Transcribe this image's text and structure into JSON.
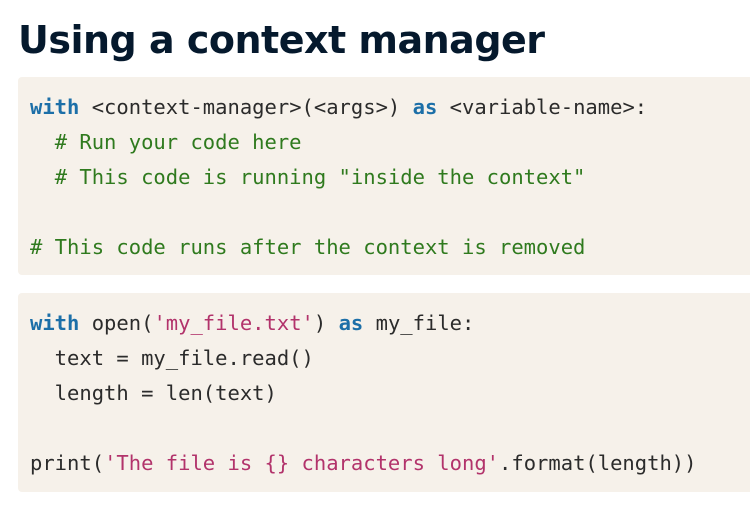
{
  "title": "Using a context manager",
  "colors": {
    "keyword": "#1c6fa8",
    "comment": "#2f7a1e",
    "string": "#b2336b",
    "plain": "#2b2b2b",
    "code_background": "#f6f1ea",
    "title": "#05192d"
  },
  "code_blocks": [
    {
      "lines": [
        [
          {
            "type": "keyword",
            "text": "with"
          },
          {
            "type": "plain",
            "text": " <context-manager>(<args>) "
          },
          {
            "type": "keyword",
            "text": "as"
          },
          {
            "type": "plain",
            "text": " <variable-name>:"
          }
        ],
        [
          {
            "type": "plain",
            "text": "  "
          },
          {
            "type": "comment",
            "text": "# Run your code here"
          }
        ],
        [
          {
            "type": "plain",
            "text": "  "
          },
          {
            "type": "comment",
            "text": "# This code is running \"inside the context\""
          }
        ],
        [],
        [
          {
            "type": "comment",
            "text": "# This code runs after the context is removed"
          }
        ]
      ]
    },
    {
      "lines": [
        [
          {
            "type": "keyword",
            "text": "with"
          },
          {
            "type": "plain",
            "text": " open("
          },
          {
            "type": "string",
            "text": "'my_file.txt'"
          },
          {
            "type": "plain",
            "text": ") "
          },
          {
            "type": "keyword",
            "text": "as"
          },
          {
            "type": "plain",
            "text": " my_file:"
          }
        ],
        [
          {
            "type": "plain",
            "text": "  text = my_file.read()"
          }
        ],
        [
          {
            "type": "plain",
            "text": "  length = len(text)"
          }
        ],
        [],
        [
          {
            "type": "plain",
            "text": "print("
          },
          {
            "type": "string",
            "text": "'The file is {} characters long'"
          },
          {
            "type": "plain",
            "text": ".format(length))"
          }
        ]
      ]
    }
  ]
}
